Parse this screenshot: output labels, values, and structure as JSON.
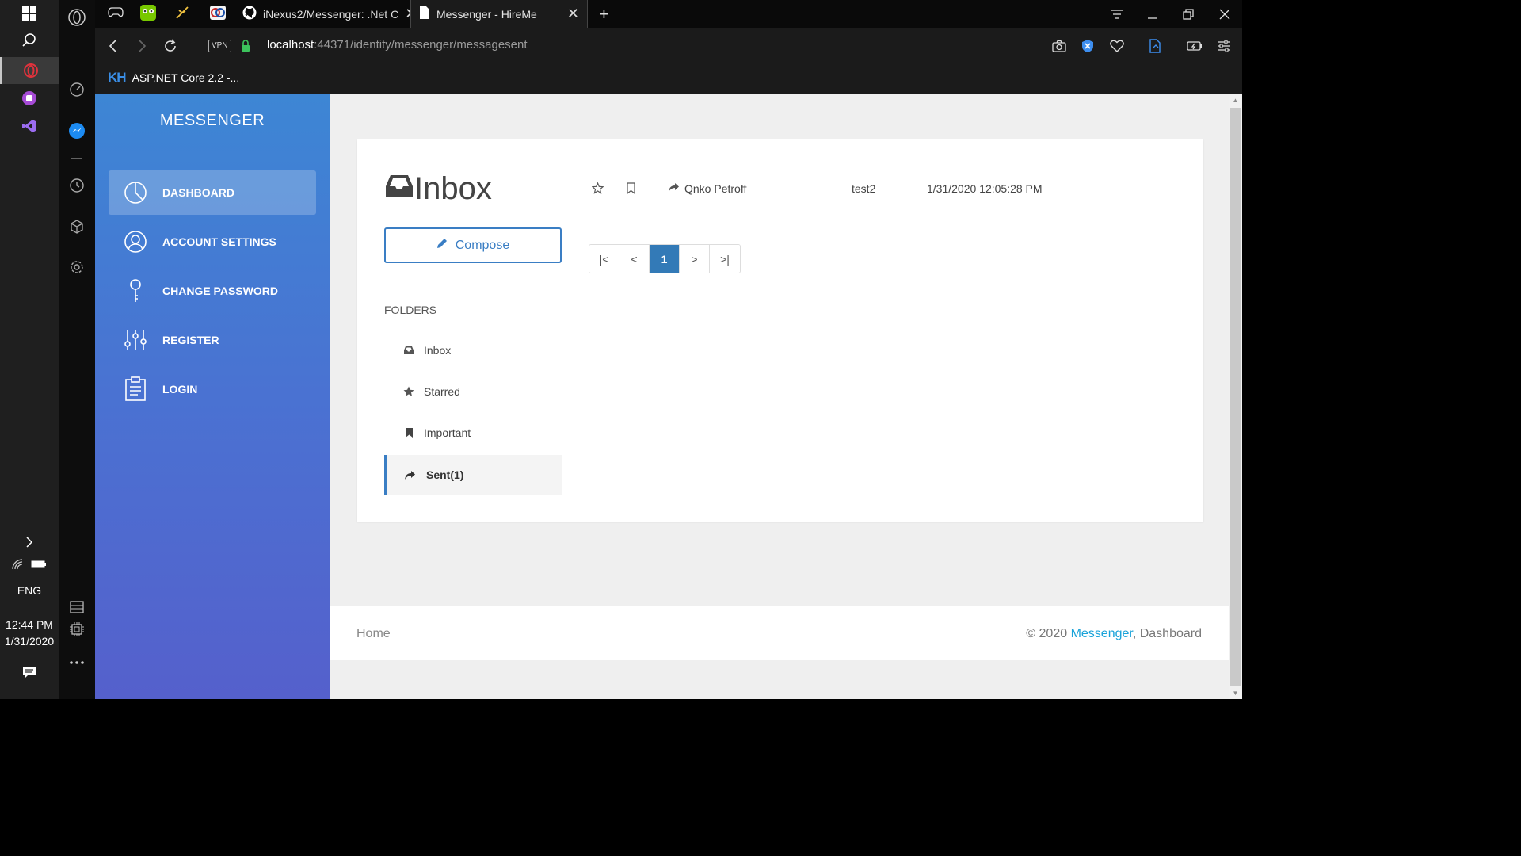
{
  "taskbar": {
    "language": "ENG",
    "time": "12:44 PM",
    "date": "1/31/2020"
  },
  "browser": {
    "tabs": [
      {
        "label": ""
      },
      {
        "label": ""
      },
      {
        "label": ""
      },
      {
        "label": ""
      },
      {
        "label": "iNexus2/Messenger: .Net C"
      },
      {
        "label": "Messenger - HireMe"
      }
    ],
    "vpn_label": "VPN",
    "url_host": "localhost",
    "url_rest": ":44371/identity/messenger/messagesent",
    "bookmark_logo": "KH",
    "bookmark_label": "ASP.NET Core 2.2 -..."
  },
  "sidebar": {
    "brand": "MESSENGER",
    "items": [
      {
        "label": "DASHBOARD",
        "icon": "pie-chart-icon"
      },
      {
        "label": "ACCOUNT SETTINGS",
        "icon": "user-icon"
      },
      {
        "label": "CHANGE PASSWORD",
        "icon": "key-icon"
      },
      {
        "label": "REGISTER",
        "icon": "sliders-icon"
      },
      {
        "label": "LOGIN",
        "icon": "clipboard-icon"
      }
    ]
  },
  "mailbox": {
    "title": "Inbox",
    "compose_label": "Compose",
    "folders_label": "FOLDERS",
    "folders": [
      {
        "label": "Inbox",
        "icon": "inbox-icon"
      },
      {
        "label": "Starred",
        "icon": "star-icon"
      },
      {
        "label": "Important",
        "icon": "bookmark-icon"
      },
      {
        "label": "Sent(1)",
        "icon": "share-icon"
      }
    ],
    "messages": [
      {
        "to": "Qnko Petroff",
        "subject": "test2",
        "date": "1/31/2020 12:05:28 PM"
      }
    ],
    "pager": {
      "first": "|<",
      "prev": "<",
      "current": "1",
      "next": ">",
      "last": ">|"
    }
  },
  "footer": {
    "home": "Home",
    "copy_prefix": "© 2020 ",
    "copy_link": "Messenger",
    "copy_suffix": ", Dashboard"
  },
  "colors": {
    "accent": "#337ab7",
    "sidebar_top": "#3d86d4",
    "sidebar_bottom": "#5560cc",
    "footer_link": "#1aa3d9"
  }
}
